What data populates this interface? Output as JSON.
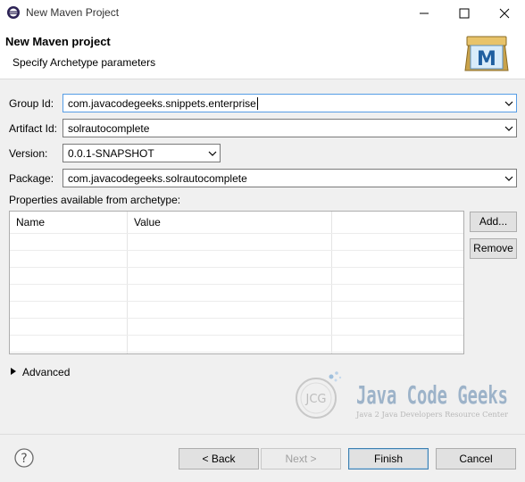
{
  "window": {
    "title": "New Maven Project"
  },
  "header": {
    "title": "New Maven project",
    "subtitle": "Specify Archetype parameters",
    "logo_letter": "M"
  },
  "form": {
    "group_id": {
      "label": "Group Id:",
      "value": "com.javacodegeeks.snippets.enterprise"
    },
    "artifact_id": {
      "label": "Artifact Id:",
      "value": "solrautocomplete"
    },
    "version": {
      "label": "Version:",
      "value": "0.0.1-SNAPSHOT"
    },
    "package": {
      "label": "Package:",
      "value": "com.javacodegeeks.solrautocomplete"
    }
  },
  "properties": {
    "label": "Properties available from archetype:",
    "columns": [
      "Name",
      "Value"
    ],
    "add_button": "Add...",
    "remove_button": "Remove"
  },
  "advanced": {
    "label": "Advanced"
  },
  "watermark": {
    "badge": "JCG",
    "name": "Java Code Geeks",
    "tagline": "Java 2 Java Developers Resource Center"
  },
  "buttons": {
    "back": "< Back",
    "next": "Next >",
    "finish": "Finish",
    "cancel": "Cancel"
  },
  "colors": {
    "accent": "#569de5",
    "jcg_blue": "#3a6fa8"
  }
}
